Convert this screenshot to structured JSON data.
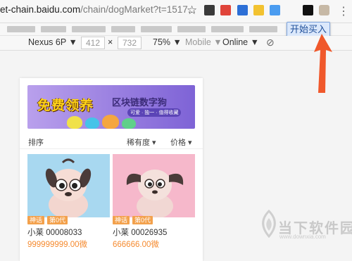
{
  "browser": {
    "url_host": "et-chain.baidu.com",
    "url_path": "/chain/dogMarket?t=1517...",
    "extension_popup_button": "开始买入"
  },
  "device_toolbar": {
    "device": "Nexus 6P ▼",
    "width": "412",
    "times": "×",
    "height": "732",
    "zoom": "75% ▼",
    "network": "Mobile ▼",
    "online": "Online ▼"
  },
  "banner": {
    "title": "免费领养",
    "title2": "区块链数字狗",
    "subtitle": "可爱 · 独一 · 值得收藏"
  },
  "sort": {
    "label": "排序",
    "rarity": "稀有度 ▾",
    "price": "价格 ▾"
  },
  "cards": [
    {
      "tag1": "神话",
      "tag2": "第0代",
      "name": "小莱 00008033",
      "price": "999999999.00微"
    },
    {
      "tag1": "神话",
      "tag2": "第0代",
      "name": "小莱 00026935",
      "price": "666666.00微"
    }
  ],
  "watermark": {
    "text": "当下软件园",
    "sub": "www.downxia.com"
  },
  "colors": {
    "popup_bg": "#dbe8fb",
    "price": "#f58a2f",
    "badge": "#f3a14c",
    "arrow": "#f0582b",
    "card1_bg": "#a8d8f0",
    "card2_bg": "#f6b8cb"
  }
}
